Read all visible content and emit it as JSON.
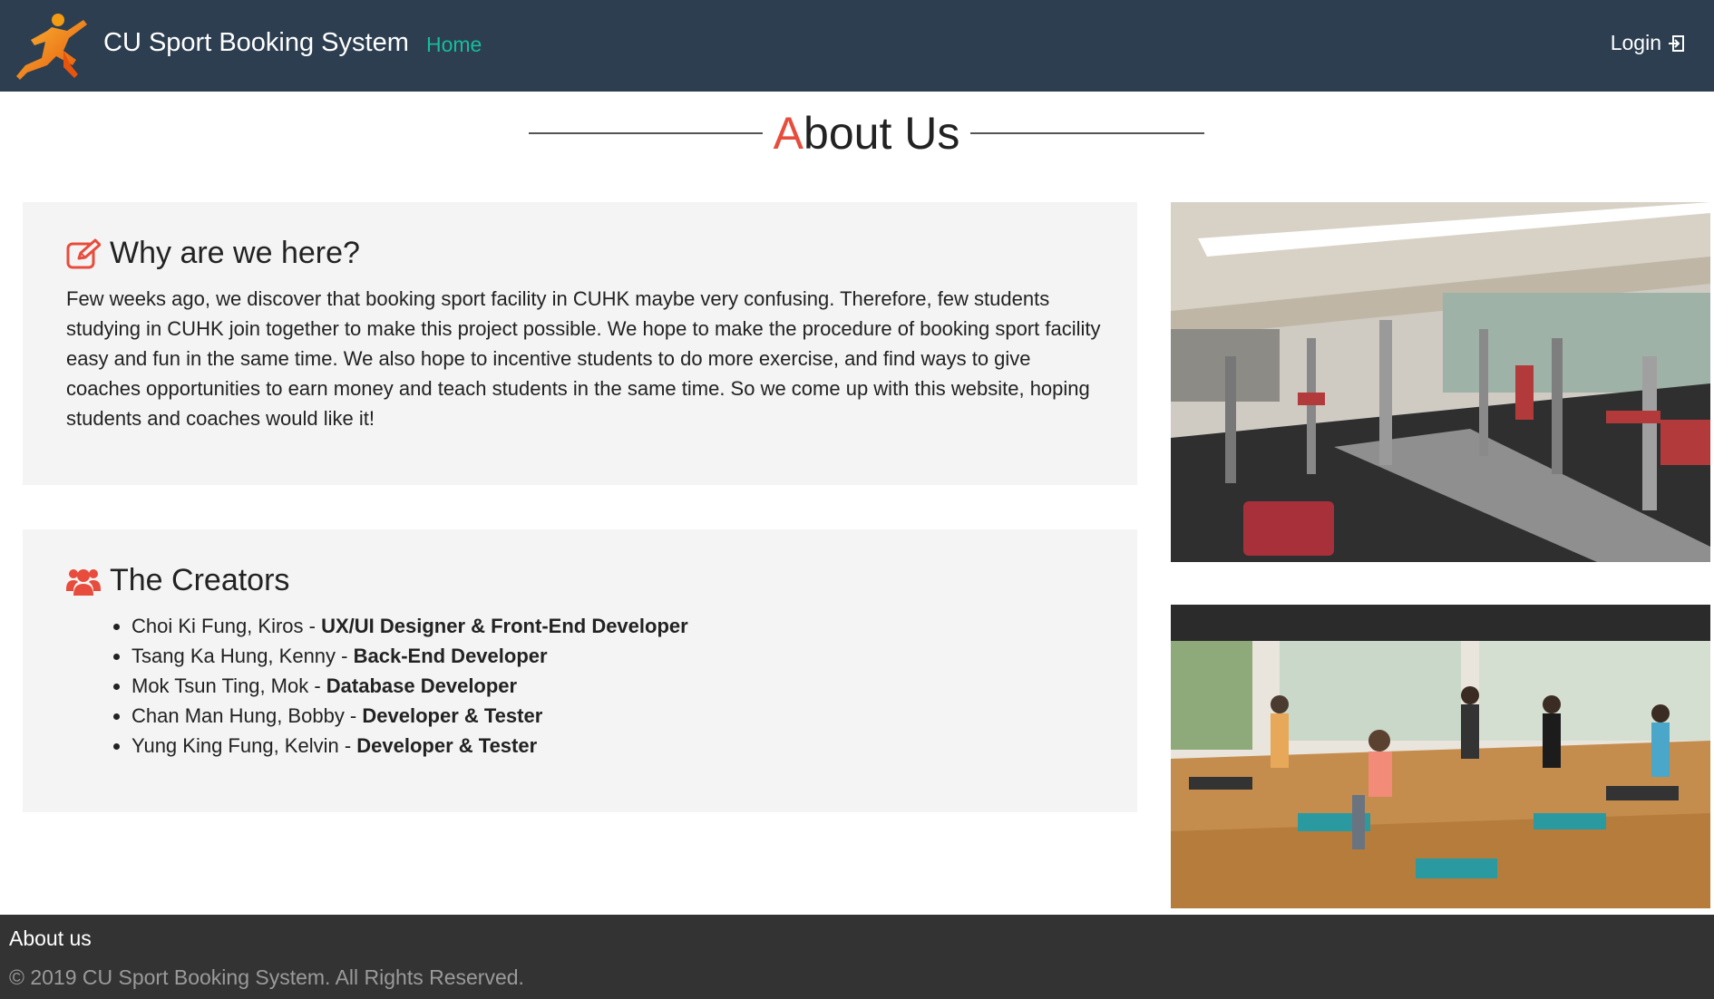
{
  "navbar": {
    "brand_title": "CU Sport Booking System",
    "home_label": "Home",
    "login_label": "Login",
    "bg_color": "#2c3e50",
    "active_link_color": "#18bc9c",
    "logo_icon": "sprinter-logo",
    "login_icon": "sign-in-icon"
  },
  "heading": {
    "first_letter": "A",
    "rest": "bout Us",
    "accent_color": "#e74c3c"
  },
  "why": {
    "icon": "edit-icon",
    "title": "Why are we here?",
    "text": "Few weeks ago, we discover that booking sport facility in CUHK maybe very confusing. Therefore, few students studying in CUHK join together to make this project possible. We hope to make the procedure of booking sport facility easy and fun in the same time. We also hope to incentive students to do more exercise, and find ways to give coaches opportunities to earn money and teach students in the same time. So we come up with this website, hoping students and coaches would like it!"
  },
  "creators": {
    "icon": "users-icon",
    "title": "The Creators",
    "members": [
      {
        "name": "Choi Ki Fung, Kiros - ",
        "role": "UX/UI Designer & Front-End Developer"
      },
      {
        "name": "Tsang Ka Hung, Kenny - ",
        "role": "Back-End Developer"
      },
      {
        "name": "Mok Tsun Ting, Mok - ",
        "role": "Database Developer"
      },
      {
        "name": "Chan Man Hung, Bobby - ",
        "role": "Developer & Tester"
      },
      {
        "name": "Yung King Fung, Kelvin - ",
        "role": "Developer & Tester"
      }
    ]
  },
  "footer": {
    "title": "About us",
    "copyright": "© 2019 CU Sport Booking System. All Rights Reserved.",
    "bg_color": "#333333"
  }
}
